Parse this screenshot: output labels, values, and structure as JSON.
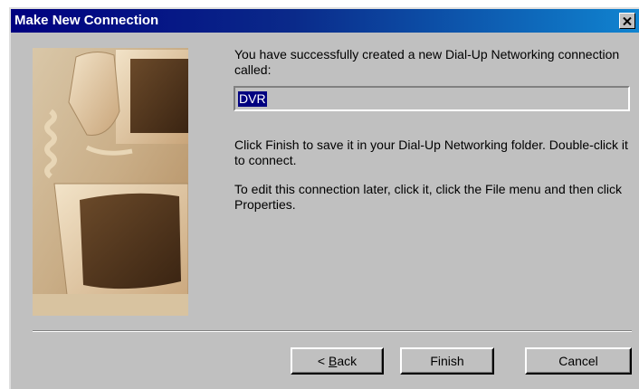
{
  "window": {
    "title": "Make New Connection",
    "close_icon": "close-icon"
  },
  "content": {
    "intro_text": "You have successfully created a new Dial-Up Networking connection called:",
    "connection_name": "DVR",
    "finish_text": "Click Finish to save it in your Dial-Up Networking folder. Double-click it to connect.",
    "edit_text": "To edit this connection later, click it, click the File menu and then click Properties."
  },
  "buttons": {
    "back_prefix": "< ",
    "back_mnemonic": "B",
    "back_rest": "ack",
    "finish": "Finish",
    "cancel": "Cancel"
  },
  "colors": {
    "title_bar_start": "#000080",
    "title_bar_end": "#1084d0",
    "dialog_face": "#c0c0c0",
    "selection": "#000080"
  }
}
